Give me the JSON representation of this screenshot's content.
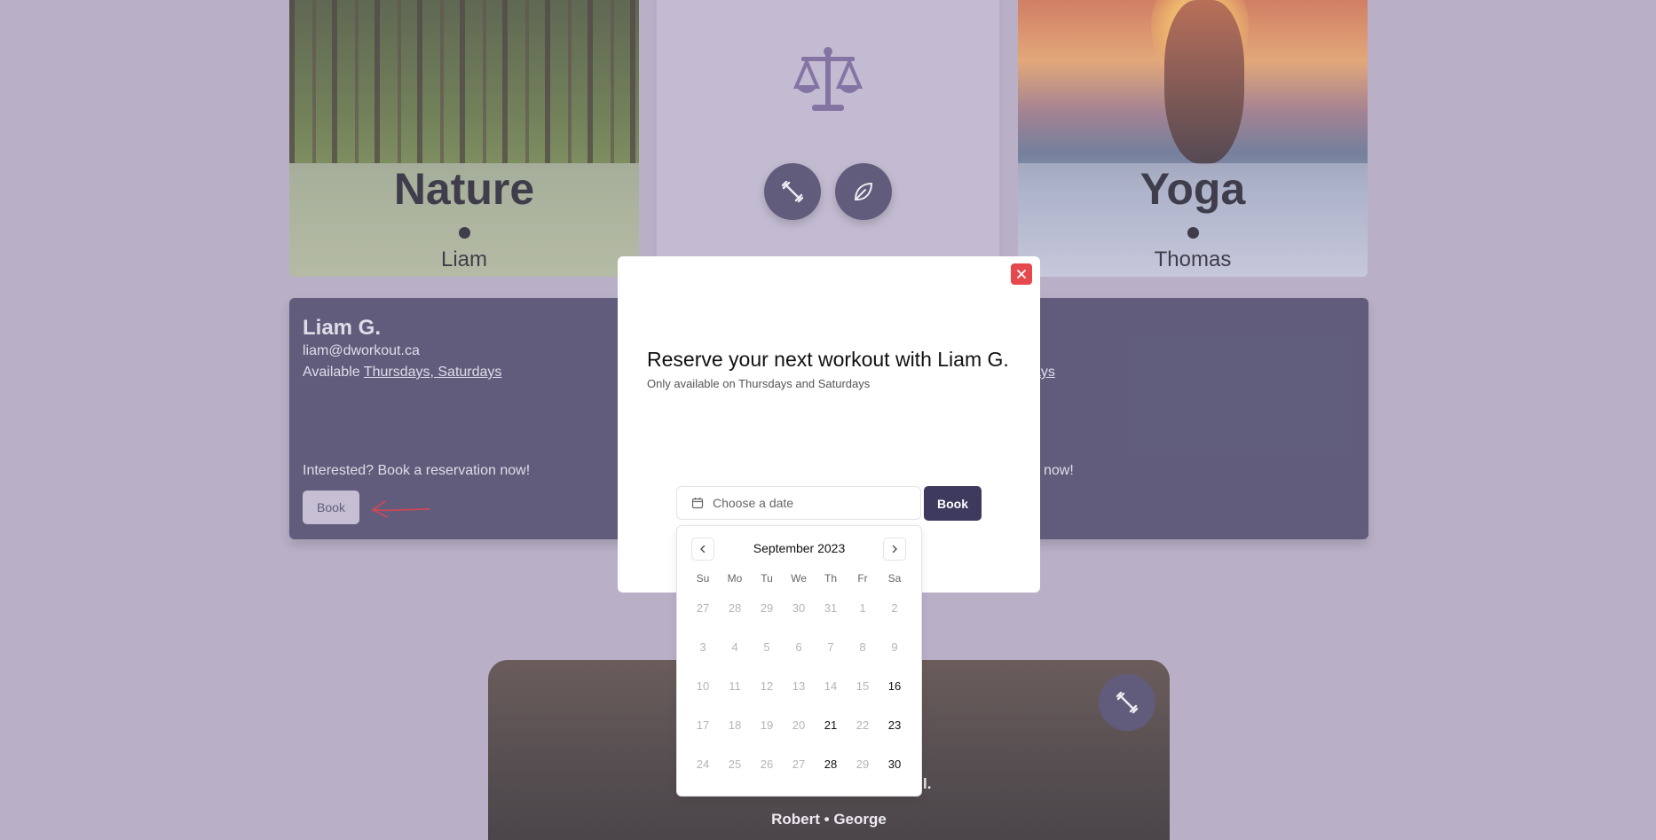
{
  "cards": {
    "left": {
      "title": "Nature",
      "name": "Liam"
    },
    "right": {
      "title": "Yoga",
      "name": "Thomas"
    }
  },
  "info": {
    "name": "Liam G.",
    "email": "liam@dworkout.ca",
    "available_prefix": "Available ",
    "available_days": "Thursdays, Saturdays",
    "cta": "Interested? Book a reservation now!",
    "book_label": "Book",
    "right_avail_fragment": "ays",
    "right_cta_fragment": "now!"
  },
  "bottom": {
    "names": "Robert • George",
    "tagline_fragment": "l."
  },
  "modal": {
    "title": "Reserve your next workout with Liam G.",
    "subtitle": "Only available on Thursdays and Saturdays",
    "date_placeholder": "Choose a date",
    "book_label": "Book"
  },
  "calendar": {
    "month": "September 2023",
    "weekdays": [
      "Su",
      "Mo",
      "Tu",
      "We",
      "Th",
      "Fr",
      "Sa"
    ],
    "weeks": [
      [
        {
          "d": "27",
          "on": false
        },
        {
          "d": "28",
          "on": false
        },
        {
          "d": "29",
          "on": false
        },
        {
          "d": "30",
          "on": false
        },
        {
          "d": "31",
          "on": false
        },
        {
          "d": "1",
          "on": false
        },
        {
          "d": "2",
          "on": false
        }
      ],
      [
        {
          "d": "3",
          "on": false
        },
        {
          "d": "4",
          "on": false
        },
        {
          "d": "5",
          "on": false
        },
        {
          "d": "6",
          "on": false
        },
        {
          "d": "7",
          "on": false
        },
        {
          "d": "8",
          "on": false
        },
        {
          "d": "9",
          "on": false
        }
      ],
      [
        {
          "d": "10",
          "on": false
        },
        {
          "d": "11",
          "on": false
        },
        {
          "d": "12",
          "on": false
        },
        {
          "d": "13",
          "on": false
        },
        {
          "d": "14",
          "on": false
        },
        {
          "d": "15",
          "on": false
        },
        {
          "d": "16",
          "on": true
        }
      ],
      [
        {
          "d": "17",
          "on": false
        },
        {
          "d": "18",
          "on": false
        },
        {
          "d": "19",
          "on": false
        },
        {
          "d": "20",
          "on": false
        },
        {
          "d": "21",
          "on": true
        },
        {
          "d": "22",
          "on": false
        },
        {
          "d": "23",
          "on": true
        }
      ],
      [
        {
          "d": "24",
          "on": false
        },
        {
          "d": "25",
          "on": false
        },
        {
          "d": "26",
          "on": false
        },
        {
          "d": "27",
          "on": false
        },
        {
          "d": "28",
          "on": true
        },
        {
          "d": "29",
          "on": false
        },
        {
          "d": "30",
          "on": true
        }
      ]
    ]
  }
}
